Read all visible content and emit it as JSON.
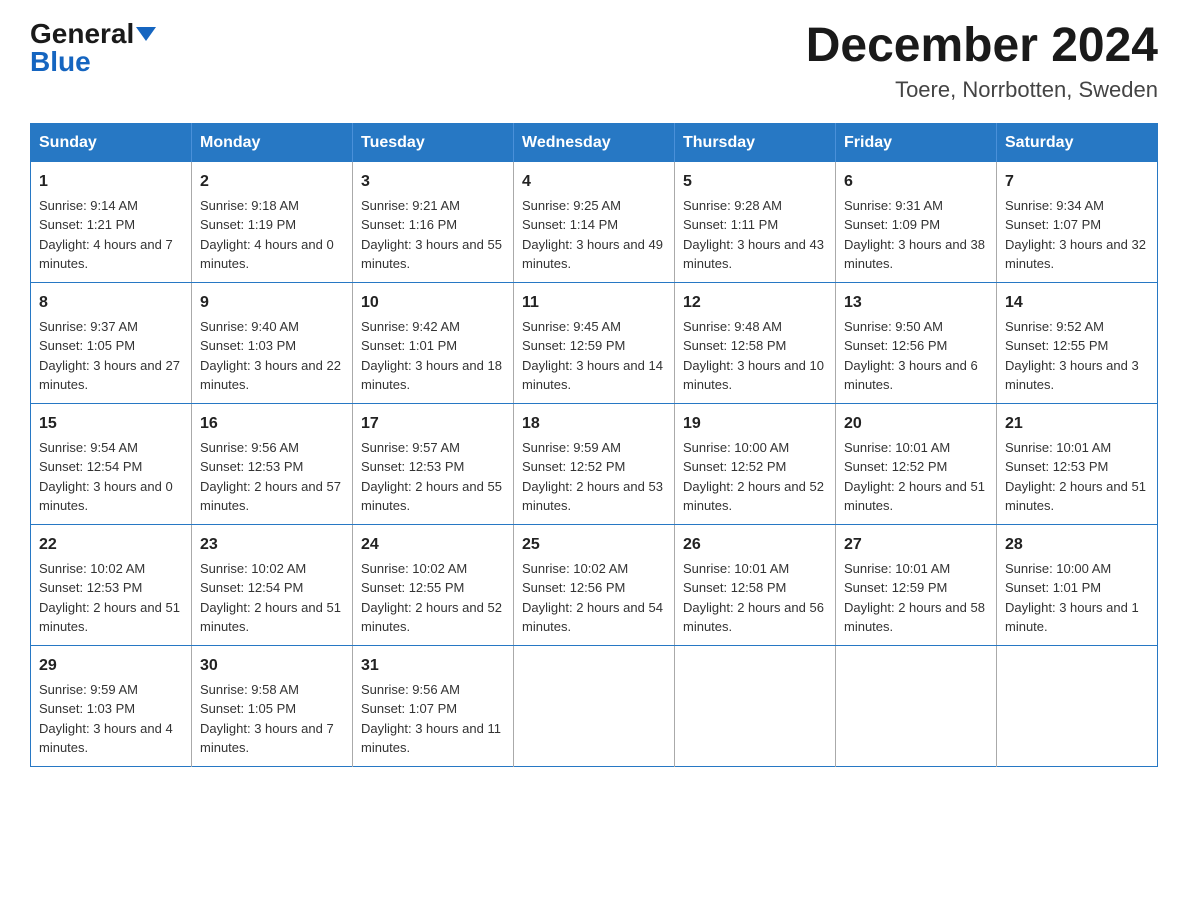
{
  "header": {
    "logo_general": "General",
    "logo_blue": "Blue",
    "month_title": "December 2024",
    "location": "Toere, Norrbotten, Sweden"
  },
  "days_of_week": [
    "Sunday",
    "Monday",
    "Tuesday",
    "Wednesday",
    "Thursday",
    "Friday",
    "Saturday"
  ],
  "weeks": [
    [
      {
        "day": "1",
        "sunrise": "9:14 AM",
        "sunset": "1:21 PM",
        "daylight": "4 hours and 7 minutes."
      },
      {
        "day": "2",
        "sunrise": "9:18 AM",
        "sunset": "1:19 PM",
        "daylight": "4 hours and 0 minutes."
      },
      {
        "day": "3",
        "sunrise": "9:21 AM",
        "sunset": "1:16 PM",
        "daylight": "3 hours and 55 minutes."
      },
      {
        "day": "4",
        "sunrise": "9:25 AM",
        "sunset": "1:14 PM",
        "daylight": "3 hours and 49 minutes."
      },
      {
        "day": "5",
        "sunrise": "9:28 AM",
        "sunset": "1:11 PM",
        "daylight": "3 hours and 43 minutes."
      },
      {
        "day": "6",
        "sunrise": "9:31 AM",
        "sunset": "1:09 PM",
        "daylight": "3 hours and 38 minutes."
      },
      {
        "day": "7",
        "sunrise": "9:34 AM",
        "sunset": "1:07 PM",
        "daylight": "3 hours and 32 minutes."
      }
    ],
    [
      {
        "day": "8",
        "sunrise": "9:37 AM",
        "sunset": "1:05 PM",
        "daylight": "3 hours and 27 minutes."
      },
      {
        "day": "9",
        "sunrise": "9:40 AM",
        "sunset": "1:03 PM",
        "daylight": "3 hours and 22 minutes."
      },
      {
        "day": "10",
        "sunrise": "9:42 AM",
        "sunset": "1:01 PM",
        "daylight": "3 hours and 18 minutes."
      },
      {
        "day": "11",
        "sunrise": "9:45 AM",
        "sunset": "12:59 PM",
        "daylight": "3 hours and 14 minutes."
      },
      {
        "day": "12",
        "sunrise": "9:48 AM",
        "sunset": "12:58 PM",
        "daylight": "3 hours and 10 minutes."
      },
      {
        "day": "13",
        "sunrise": "9:50 AM",
        "sunset": "12:56 PM",
        "daylight": "3 hours and 6 minutes."
      },
      {
        "day": "14",
        "sunrise": "9:52 AM",
        "sunset": "12:55 PM",
        "daylight": "3 hours and 3 minutes."
      }
    ],
    [
      {
        "day": "15",
        "sunrise": "9:54 AM",
        "sunset": "12:54 PM",
        "daylight": "3 hours and 0 minutes."
      },
      {
        "day": "16",
        "sunrise": "9:56 AM",
        "sunset": "12:53 PM",
        "daylight": "2 hours and 57 minutes."
      },
      {
        "day": "17",
        "sunrise": "9:57 AM",
        "sunset": "12:53 PM",
        "daylight": "2 hours and 55 minutes."
      },
      {
        "day": "18",
        "sunrise": "9:59 AM",
        "sunset": "12:52 PM",
        "daylight": "2 hours and 53 minutes."
      },
      {
        "day": "19",
        "sunrise": "10:00 AM",
        "sunset": "12:52 PM",
        "daylight": "2 hours and 52 minutes."
      },
      {
        "day": "20",
        "sunrise": "10:01 AM",
        "sunset": "12:52 PM",
        "daylight": "2 hours and 51 minutes."
      },
      {
        "day": "21",
        "sunrise": "10:01 AM",
        "sunset": "12:53 PM",
        "daylight": "2 hours and 51 minutes."
      }
    ],
    [
      {
        "day": "22",
        "sunrise": "10:02 AM",
        "sunset": "12:53 PM",
        "daylight": "2 hours and 51 minutes."
      },
      {
        "day": "23",
        "sunrise": "10:02 AM",
        "sunset": "12:54 PM",
        "daylight": "2 hours and 51 minutes."
      },
      {
        "day": "24",
        "sunrise": "10:02 AM",
        "sunset": "12:55 PM",
        "daylight": "2 hours and 52 minutes."
      },
      {
        "day": "25",
        "sunrise": "10:02 AM",
        "sunset": "12:56 PM",
        "daylight": "2 hours and 54 minutes."
      },
      {
        "day": "26",
        "sunrise": "10:01 AM",
        "sunset": "12:58 PM",
        "daylight": "2 hours and 56 minutes."
      },
      {
        "day": "27",
        "sunrise": "10:01 AM",
        "sunset": "12:59 PM",
        "daylight": "2 hours and 58 minutes."
      },
      {
        "day": "28",
        "sunrise": "10:00 AM",
        "sunset": "1:01 PM",
        "daylight": "3 hours and 1 minute."
      }
    ],
    [
      {
        "day": "29",
        "sunrise": "9:59 AM",
        "sunset": "1:03 PM",
        "daylight": "3 hours and 4 minutes."
      },
      {
        "day": "30",
        "sunrise": "9:58 AM",
        "sunset": "1:05 PM",
        "daylight": "3 hours and 7 minutes."
      },
      {
        "day": "31",
        "sunrise": "9:56 AM",
        "sunset": "1:07 PM",
        "daylight": "3 hours and 11 minutes."
      },
      null,
      null,
      null,
      null
    ]
  ]
}
